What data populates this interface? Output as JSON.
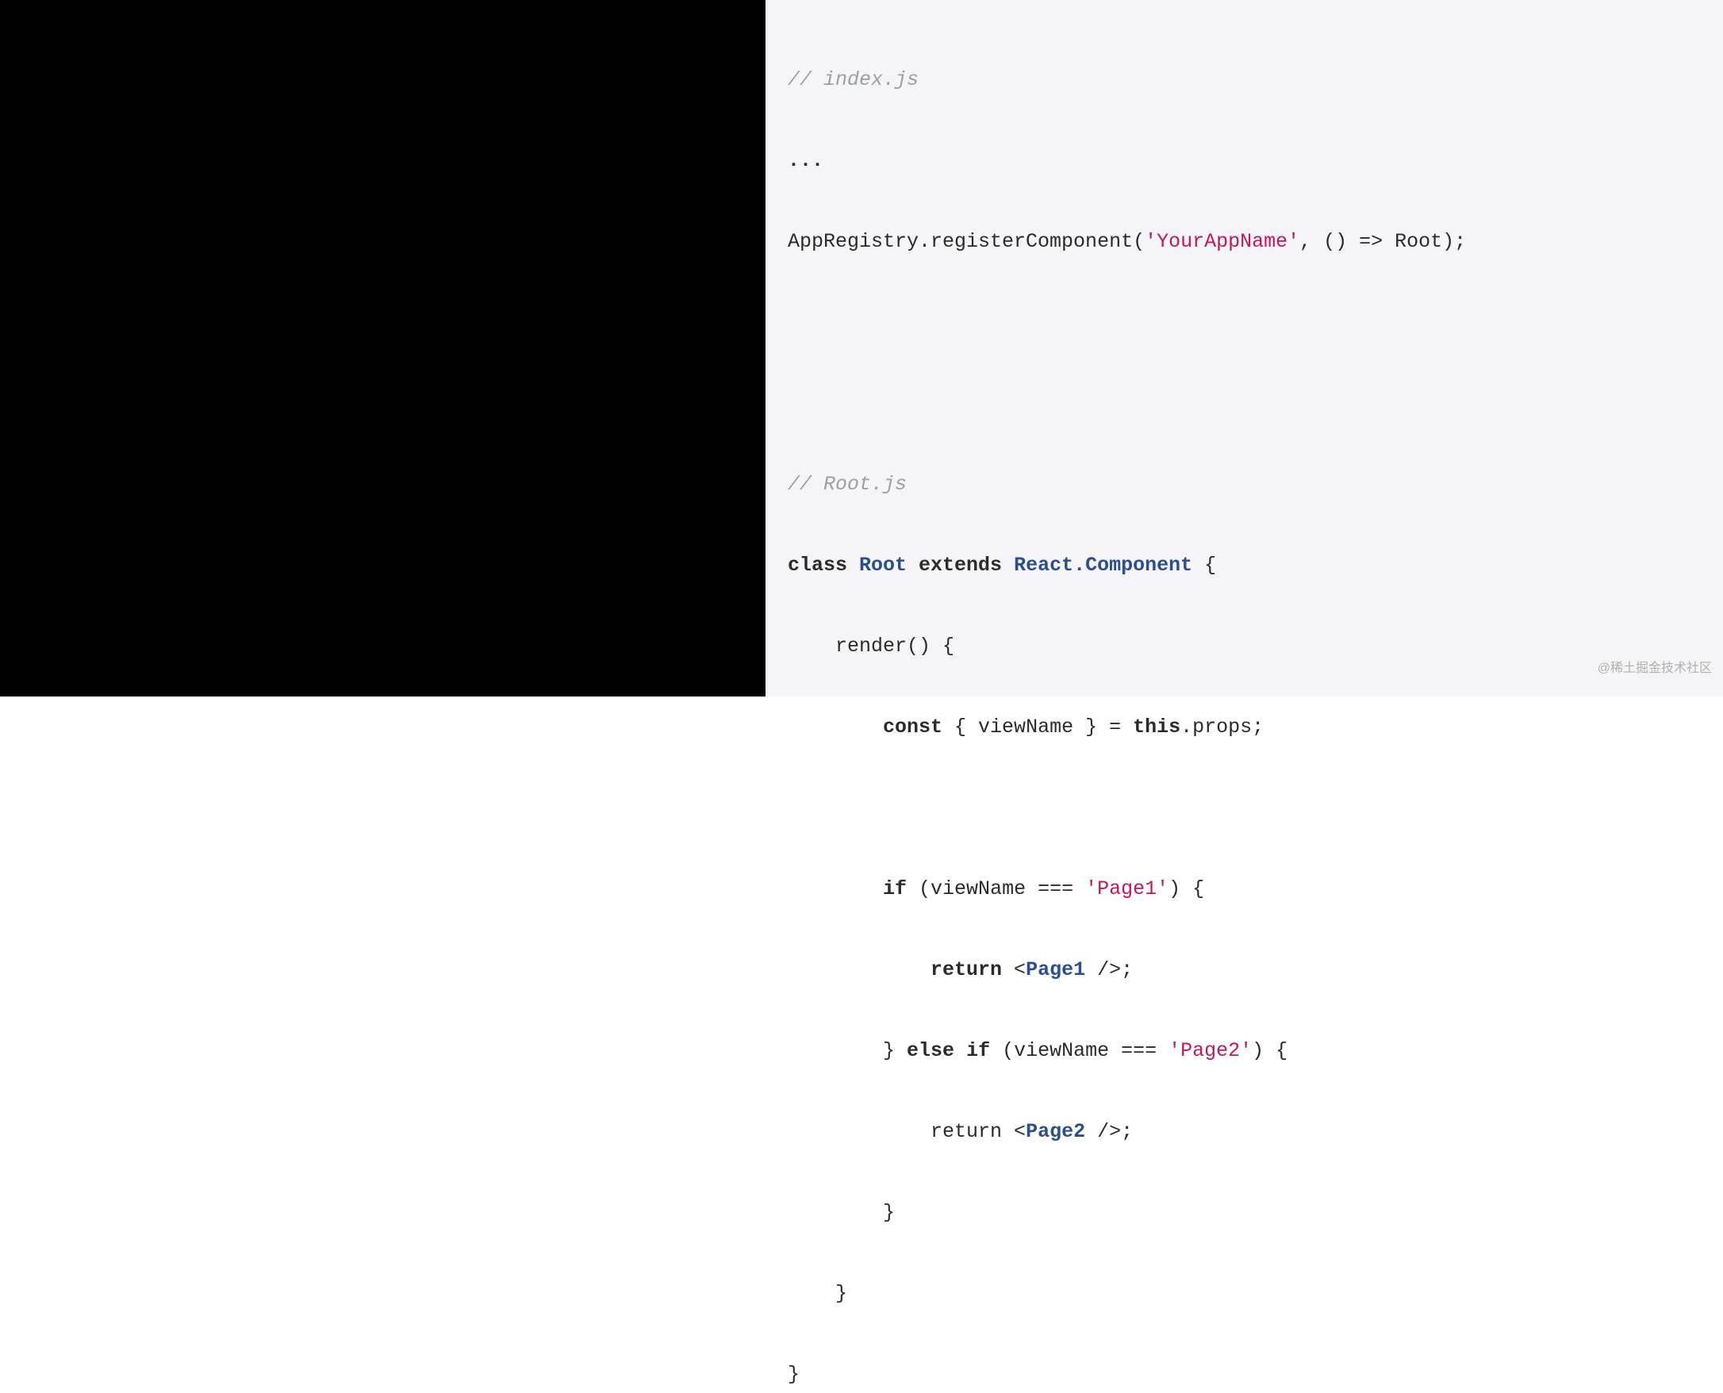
{
  "code": {
    "comment_index": "// index.js",
    "ellipsis": "...",
    "line3_a": "AppRegistry.registerComponent(",
    "line3_str": "'YourAppName'",
    "line3_b": ", () => Root);",
    "comment_root": "// Root.js",
    "l_class": "class",
    "l_rootname": " Root ",
    "l_extends": "extends",
    "l_react_component": " React.Component ",
    "l_openbrace": "{",
    "l_render": "    render() {",
    "l_const": "const",
    "l_destruct_a": " { viewName } = ",
    "l_this": "this",
    "l_props": ".props;",
    "l_if": "if",
    "l_if_cond_a": " (viewName === ",
    "l_page1_str": "'Page1'",
    "l_if_cond_b": ") {",
    "l_return": "return",
    "l_page1_open": " <",
    "l_page1_tag": "Page1",
    "l_page1_close": " />",
    "l_semicolon": ";",
    "l_else_a": "        } ",
    "l_else": "else",
    "l_elseif_a": " ",
    "l_elseif_cond_a": " (viewName === ",
    "l_page2_str": "'Page2'",
    "l_elseif_cond_b": ") {",
    "l_return2_a": "            return <",
    "l_page2_tag": "Page2",
    "l_return2_b": " />;",
    "l_close_inner": "        }",
    "l_close_render": "    }",
    "l_close_class": "}"
  },
  "watermark": "@稀土掘金技术社区"
}
